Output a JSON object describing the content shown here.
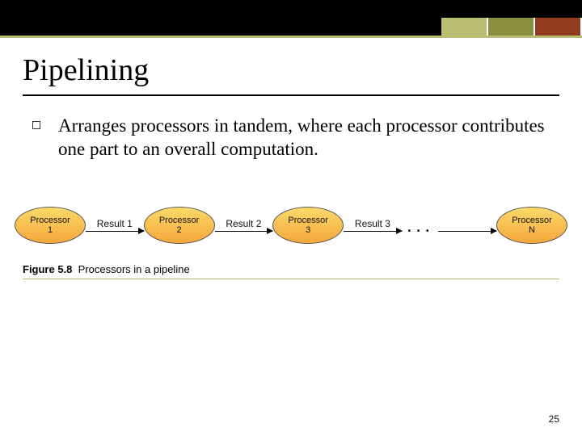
{
  "colors": {
    "accent1": "#b9bd72",
    "accent2": "#8a8e3f",
    "accent3": "#923c1f",
    "accent_rule": "#b9bd72"
  },
  "title": "Pipelining",
  "bullet": "Arranges processors in tandem, where each processor contributes one part to an overall computation.",
  "diagram": {
    "processor_label": "Processor",
    "processors": [
      "1",
      "2",
      "3",
      "N"
    ],
    "arrows": [
      "Result 1",
      "Result 2",
      "Result 3"
    ],
    "ellipsis": "..."
  },
  "caption_prefix": "Figure 5.8",
  "caption_text": "Processors in a pipeline",
  "page_number": "25"
}
